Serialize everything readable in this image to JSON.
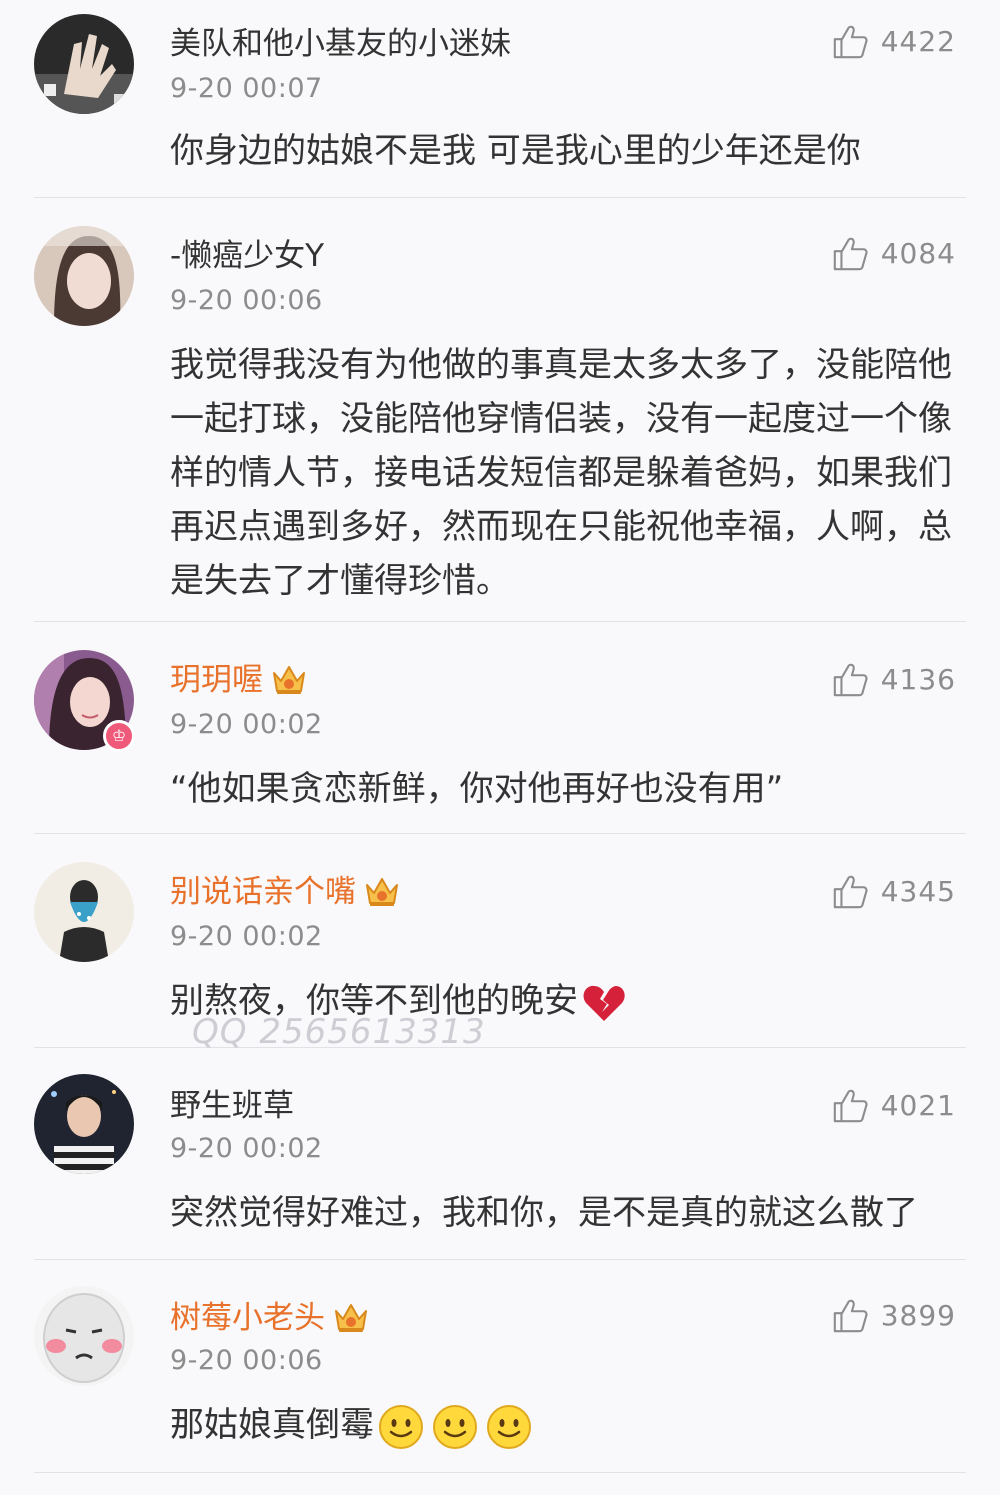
{
  "comments": [
    {
      "username": "美队和他小基友的小迷妹",
      "vip": false,
      "timestamp": "9-20 00:07",
      "likes": "4422",
      "text": "你身边的姑娘不是我 可是我心里的少年还是你"
    },
    {
      "username": "-懒癌少女Y",
      "vip": false,
      "timestamp": "9-20 00:06",
      "likes": "4084",
      "text": "我觉得我没有为他做的事真是太多太多了，没能陪他一起打球，没能陪他穿情侣装，没有一起度过一个像样的情人节，接电话发短信都是躲着爸妈，如果我们再迟点遇到多好，然而现在只能祝他幸福，人啊，总是失去了才懂得珍惜。"
    },
    {
      "username": "玥玥喔",
      "vip": true,
      "timestamp": "9-20 00:02",
      "likes": "4136",
      "text": "“他如果贪恋新鲜，你对他再好也没有用”"
    },
    {
      "username": "别说话亲个嘴",
      "vip": true,
      "timestamp": "9-20 00:02",
      "likes": "4345",
      "text": "别熬夜，你等不到他的晚安",
      "emoji": "broken-heart-icon"
    },
    {
      "username": "野生班草",
      "vip": false,
      "timestamp": "9-20 00:02",
      "likes": "4021",
      "text": "突然觉得好难过，我和你，是不是真的就这么散了"
    },
    {
      "username": "树莓小老头",
      "vip": true,
      "timestamp": "9-20 00:06",
      "likes": "3899",
      "text": "那姑娘真倒霉",
      "emoji": "smile-icon x3"
    }
  ],
  "watermark": "QQ 2565613313",
  "colors": {
    "vip_name": "#e8722b",
    "name": "#333333",
    "meta": "#8c8c8c",
    "background": "#f9f9fb"
  }
}
